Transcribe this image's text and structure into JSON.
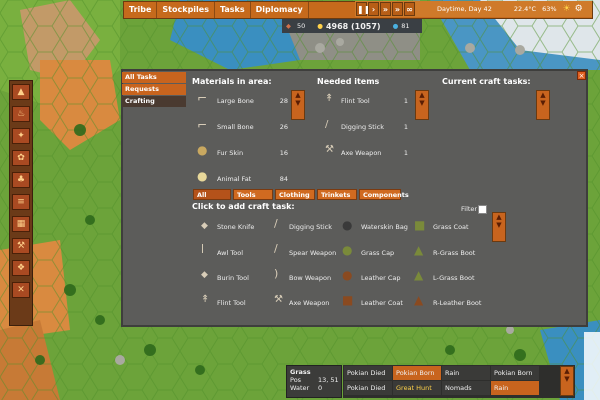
{
  "top_menu": {
    "tribe": "Tribe",
    "stockpiles": "Stockpiles",
    "tasks": "Tasks",
    "diplomacy": "Diplomacy"
  },
  "top_status": {
    "speed_icon": "fast-forward-icon",
    "date": "Daytime, Day 42",
    "temperature": "22.4°C",
    "humidity": "63%",
    "food_count": "50",
    "wealth": "4968 (1057)",
    "water_count": "81"
  },
  "category_menu": {
    "items": [
      "All Tasks",
      "Requests",
      "Crafting"
    ]
  },
  "materials": {
    "title": "Materials in area:",
    "items": [
      {
        "name": "Large Bone",
        "count": "28",
        "icon": "large-bone-icon"
      },
      {
        "name": "Small Bone",
        "count": "26",
        "icon": "small-bone-icon"
      },
      {
        "name": "Fur Skin",
        "count": "16",
        "icon": "fur-skin-icon"
      },
      {
        "name": "Animal Fat",
        "count": "84",
        "icon": "animal-fat-icon"
      }
    ]
  },
  "needed": {
    "title": "Needed items",
    "items": [
      {
        "name": "Flint Tool",
        "count": "1"
      },
      {
        "name": "Digging Stick",
        "count": "1"
      },
      {
        "name": "Axe Weapon",
        "count": "1"
      }
    ]
  },
  "current": {
    "title": "Current craft tasks:"
  },
  "filter_tabs": [
    "All",
    "Tools",
    "Clothing",
    "Trinkets",
    "Components"
  ],
  "add_tasks": {
    "title": "Click to add craft task:",
    "filter_label": "Filter",
    "columns": [
      [
        "Stone Knife",
        "Awl Tool",
        "Burin Tool",
        "Flint Tool"
      ],
      [
        "Digging Stick",
        "Spear Weapon",
        "Bow Weapon",
        "Axe Weapon"
      ],
      [
        "Waterskin Bag",
        "Grass Cap",
        "Leather Cap",
        "Leather Coat"
      ],
      [
        "Grass Coat",
        "R-Grass Boot",
        "L-Grass Boot",
        "R-Leather Boot"
      ]
    ]
  },
  "tile_info": {
    "terrain": "Grass",
    "pos_label": "Pos",
    "pos_value": "13, 51",
    "water_label": "Water",
    "water_value": "0"
  },
  "event_log": {
    "row1": [
      "Pokian Died",
      "Pokian Born",
      "Rain",
      "Pokian Born"
    ],
    "row2": [
      "Pokian Died",
      "Great Hunt",
      "Nomads",
      "Rain"
    ]
  },
  "colors": {
    "accent_orange": "#c8641e",
    "panel_gray": "#5c5c5a",
    "highlight_yellow": "#ffd24a"
  }
}
